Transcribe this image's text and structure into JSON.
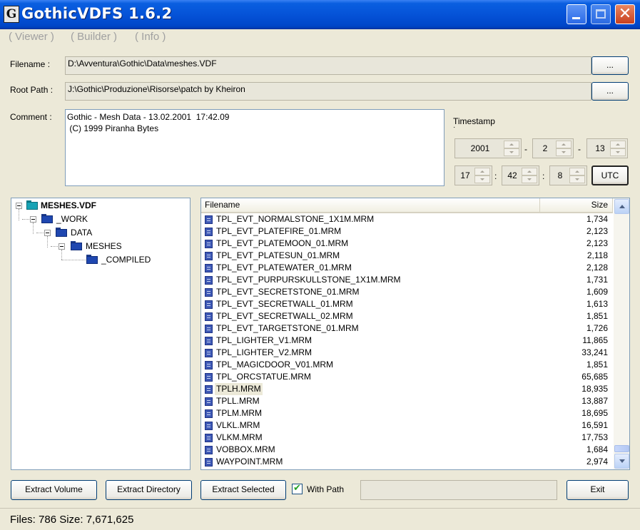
{
  "window": {
    "title": "GothicVDFS 1.6.2",
    "app_icon_letter": "G"
  },
  "menu": [
    "( Viewer )",
    "( Builder )",
    "( Info )"
  ],
  "form": {
    "filename_label": "Filename :",
    "filename_value": "D:\\Avventura\\Gothic\\Data\\meshes.VDF",
    "browse_label": "...",
    "rootpath_label": "Root Path :",
    "rootpath_value": "J:\\Gothic\\Produzione\\Risorse\\patch by Kheiron",
    "comment_label": "Comment :",
    "comment_value": "Gothic - Mesh Data - 13.02.2001  17:42.09\n (C) 1999 Piranha Bytes"
  },
  "timestamp": {
    "label": "Timestamp",
    "year": "2001",
    "month": "2",
    "day": "13",
    "hour": "17",
    "minute": "42",
    "second": "8",
    "date_sep": "-",
    "time_sep": ":",
    "utc_label": "UTC"
  },
  "tree": [
    "MESHES.VDF",
    "_WORK",
    "DATA",
    "MESHES",
    "_COMPILED"
  ],
  "list": {
    "col_filename": "Filename",
    "col_size": "Size",
    "rows": [
      {
        "name": "TPL_EVT_NORMALSTONE_1X1M.MRM",
        "size": "1,734"
      },
      {
        "name": "TPL_EVT_PLATEFIRE_01.MRM",
        "size": "2,123"
      },
      {
        "name": "TPL_EVT_PLATEMOON_01.MRM",
        "size": "2,123"
      },
      {
        "name": "TPL_EVT_PLATESUN_01.MRM",
        "size": "2,118"
      },
      {
        "name": "TPL_EVT_PLATEWATER_01.MRM",
        "size": "2,128"
      },
      {
        "name": "TPL_EVT_PURPURSKULLSTONE_1X1M.MRM",
        "size": "1,731"
      },
      {
        "name": "TPL_EVT_SECRETSTONE_01.MRM",
        "size": "1,609"
      },
      {
        "name": "TPL_EVT_SECRETWALL_01.MRM",
        "size": "1,613"
      },
      {
        "name": "TPL_EVT_SECRETWALL_02.MRM",
        "size": "1,851"
      },
      {
        "name": "TPL_EVT_TARGETSTONE_01.MRM",
        "size": "1,726"
      },
      {
        "name": "TPL_LIGHTER_V1.MRM",
        "size": "11,865"
      },
      {
        "name": "TPL_LIGHTER_V2.MRM",
        "size": "33,241"
      },
      {
        "name": "TPL_MAGICDOOR_V01.MRM",
        "size": "1,851"
      },
      {
        "name": "TPL_ORCSTATUE.MRM",
        "size": "65,685"
      },
      {
        "name": "TPLH.MRM",
        "size": "18,935"
      },
      {
        "name": "TPLL.MRM",
        "size": "13,887"
      },
      {
        "name": "TPLM.MRM",
        "size": "18,695"
      },
      {
        "name": "VLKL.MRM",
        "size": "16,591"
      },
      {
        "name": "VLKM.MRM",
        "size": "17,753"
      },
      {
        "name": "VOBBOX.MRM",
        "size": "1,684"
      },
      {
        "name": "WAYPOINT.MRM",
        "size": "2,974"
      }
    ],
    "selected_index": 14
  },
  "actions": {
    "extract_volume": "Extract Volume",
    "extract_directory": "Extract Directory",
    "extract_selected": "Extract Selected",
    "with_path": "With Path",
    "exit": "Exit"
  },
  "status": "Files: 786  Size: 7,671,625"
}
